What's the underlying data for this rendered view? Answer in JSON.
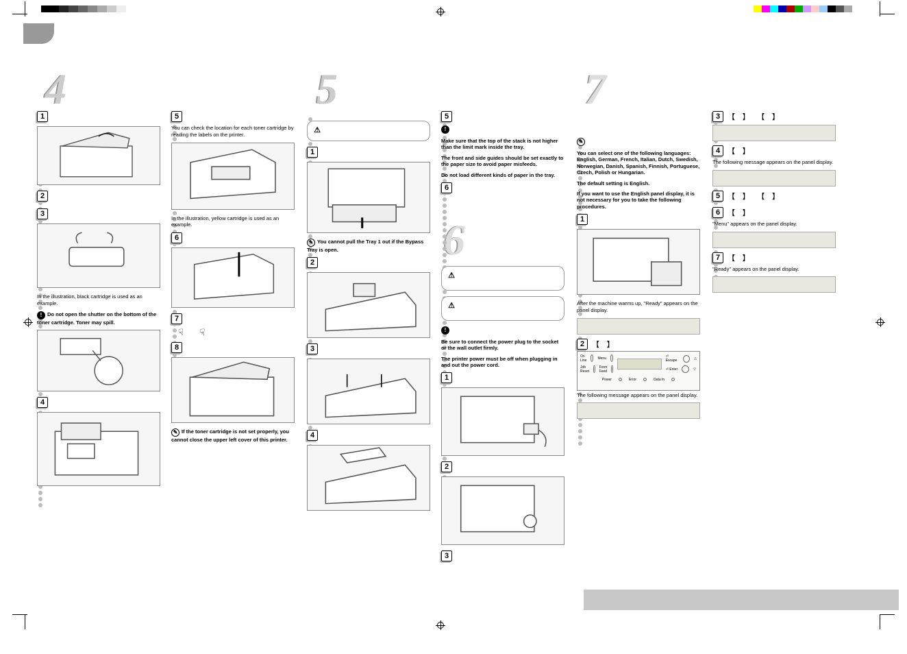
{
  "col1": {
    "s3": {
      "caption": "In the illustration, black cartridge is used as an example.",
      "warnA": "Do not open the shutter on the bottom of the toner cartridge. Toner may spill."
    }
  },
  "col2": {
    "intro": "You can check the location for each toner cartridge by reading the labels on the printer.",
    "s5cap": "In the illustration, yellow cartridge is used as an example.",
    "s8note": "If the toner cartridge is not set properly, you cannot close the upper left cover of this printer."
  },
  "col3": {
    "s1note": "You cannot pull the Tray 1 out if the Bypass Tray is open."
  },
  "col4": {
    "s5a": "Make sure that the top of the stack is not higher than the limit mark inside the tray.",
    "s5b": "The front and side guides should be set exactly to the paper size to avoid paper misfeeds.",
    "s5c": "Do not load different kinds of paper in the tray.",
    "s6impA": "Be sure to connect the power plug to the socket or the wall outlet firmly.",
    "s6impB": "The printer power must be off when plugging in and out the power cord."
  },
  "col5": {
    "note1": "You can select one of the following languages: English, German, French, Italian, Dutch, Swedish, Norwegian, Danish, Spanish, Finnish, Portuguese, Czech, Polish or Hungarian.",
    "note2": "The default setting is English.",
    "note3": "If you want to use the English panel display, it is not necessary for you to take the following procedures.",
    "s1cap": "After the machine warms up, \"Ready\" appears on the panel display.",
    "s2cap": "The following message appears on the panel display.",
    "panel": {
      "online": "On Line",
      "menu": "Menu",
      "jobreset": "Job Reset",
      "formfeed": "Form Feed",
      "power": "Power",
      "error": "Error",
      "datain": "Data In",
      "escape": "⏎ Escape",
      "enter": "⏎ Enter"
    }
  },
  "col6": {
    "s4cap": "The following message appears on the panel display.",
    "s6cap": "\"Menu\" appears on the panel display.",
    "s7cap": "\"Ready\" appears on the panel display."
  },
  "brackets": {
    "pair": "【  】 【  】",
    "single": "【    】"
  }
}
